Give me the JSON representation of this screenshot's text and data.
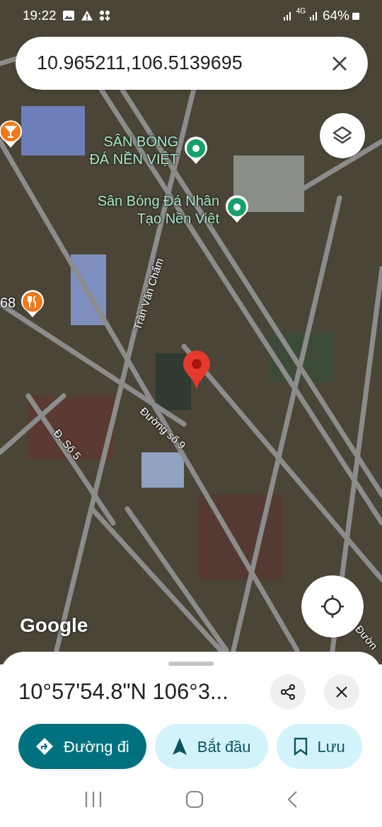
{
  "status_bar": {
    "time": "19:22",
    "network": "4G",
    "battery": "64%"
  },
  "search": {
    "value": "10.965211,106.5139695"
  },
  "map": {
    "labels": [
      {
        "kind": "place",
        "lines": [
          "SÂN BÓNG",
          "ĐÁ NỀN VIỆT"
        ]
      },
      {
        "kind": "place",
        "lines": [
          "Sân Bóng Đá Nhân",
          "Tạo Nền Việt"
        ]
      },
      {
        "kind": "street",
        "lines": [
          "Trần Văn Chẩm"
        ]
      },
      {
        "kind": "street",
        "lines": [
          "Đường số 9"
        ]
      },
      {
        "kind": "street",
        "lines": [
          "Đ. Số 5"
        ]
      },
      {
        "kind": "street",
        "lines": [
          "Đườn"
        ]
      },
      {
        "kind": "poi",
        "lines": [
          "68"
        ]
      }
    ],
    "attribution": "Google"
  },
  "sheet": {
    "title": "10°57'54.8\"N 106°3...",
    "actions": [
      {
        "kind": "primary",
        "label": "Đường đi"
      },
      {
        "kind": "tonal",
        "label": "Bắt đầu"
      },
      {
        "kind": "tonal",
        "label": "Lưu"
      }
    ]
  }
}
